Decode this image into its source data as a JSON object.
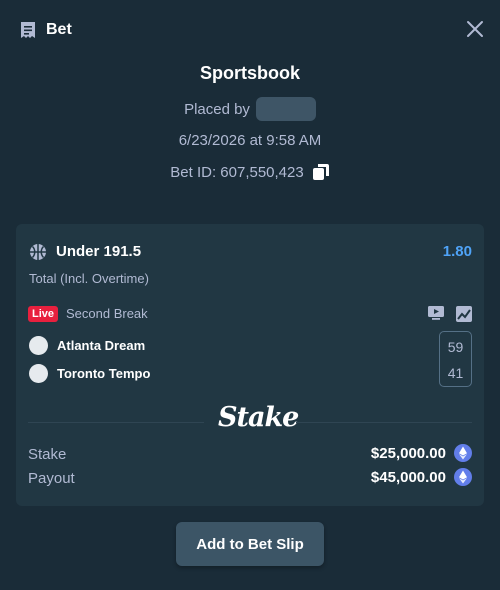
{
  "header": {
    "title": "Bet",
    "icon": "receipt-icon"
  },
  "summary": {
    "title": "Sportsbook",
    "placed_by_label": "Placed by",
    "datetime": "6/23/2026 at 9:58 AM",
    "bet_id": "Bet ID: 607,550,423"
  },
  "bet": {
    "market": "Under 191.5",
    "odds": "1.80",
    "market_type": "Total (Incl. Overtime)",
    "live_badge": "Live",
    "status": "Second Break",
    "teams": [
      {
        "name": "Atlanta Dream",
        "score": "59"
      },
      {
        "name": "Toronto Tempo",
        "score": "41"
      }
    ],
    "brand": "Stake",
    "stake_label": "Stake",
    "stake_value": "$25,000.00",
    "payout_label": "Payout",
    "payout_value": "$45,000.00",
    "currency_icon": "ethereum-icon"
  },
  "actions": {
    "add_to_slip": "Add to Bet Slip"
  },
  "colors": {
    "background": "#1a2c38",
    "card": "#213743",
    "odds": "#4fa3f7",
    "live": "#e8203e",
    "eth": "#627eea"
  }
}
